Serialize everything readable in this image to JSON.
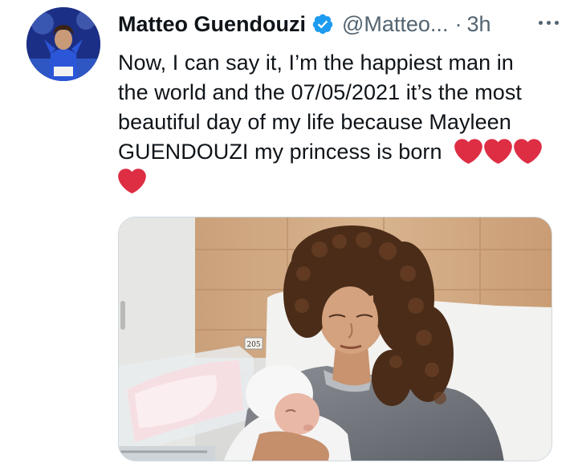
{
  "tweet": {
    "author": {
      "display_name": "Matteo Guendouzi",
      "handle": "@Matteo...",
      "verified": true,
      "avatar_icon": "profile-photo"
    },
    "separator": "·",
    "timestamp": "3h",
    "more_icon": "more-horizontal-icon",
    "text_lines": [
      "Now, I can say it, I’m the happiest man in",
      "the world and the 07/05/2021 it’s the most",
      "beautiful day of my life because Mayleen",
      "GUENDOUZI my princess is born"
    ],
    "emoji": [
      "red-heart",
      "red-heart",
      "red-heart",
      "red-heart"
    ],
    "media": {
      "type": "photo",
      "room_sign": "205"
    }
  },
  "colors": {
    "verified_blue": "#1d9bf0",
    "heart_red": "#dd2e44",
    "secondary_text": "#536471"
  }
}
